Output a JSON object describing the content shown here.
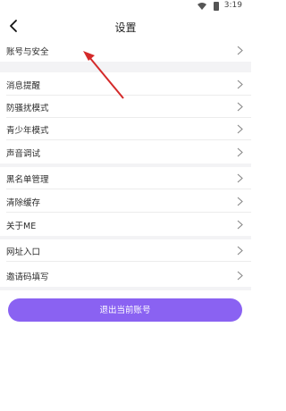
{
  "status": {
    "time": "3:19"
  },
  "header": {
    "title": "设置"
  },
  "groups": [
    {
      "items": [
        "账号与安全"
      ]
    },
    {
      "items": [
        "消息提醒",
        "防骚扰模式",
        "青少年模式",
        "声音调试"
      ]
    },
    {
      "items": [
        "黑名单管理",
        "清除缓存",
        "关于ME"
      ]
    },
    {
      "items": [
        "网址入口",
        "邀请码填写"
      ]
    }
  ],
  "logout_label": "退出当前账号",
  "colors": {
    "accent": "#8a62f2",
    "annotation_arrow": "#d42a2a",
    "divider": "#f3f3f5"
  }
}
